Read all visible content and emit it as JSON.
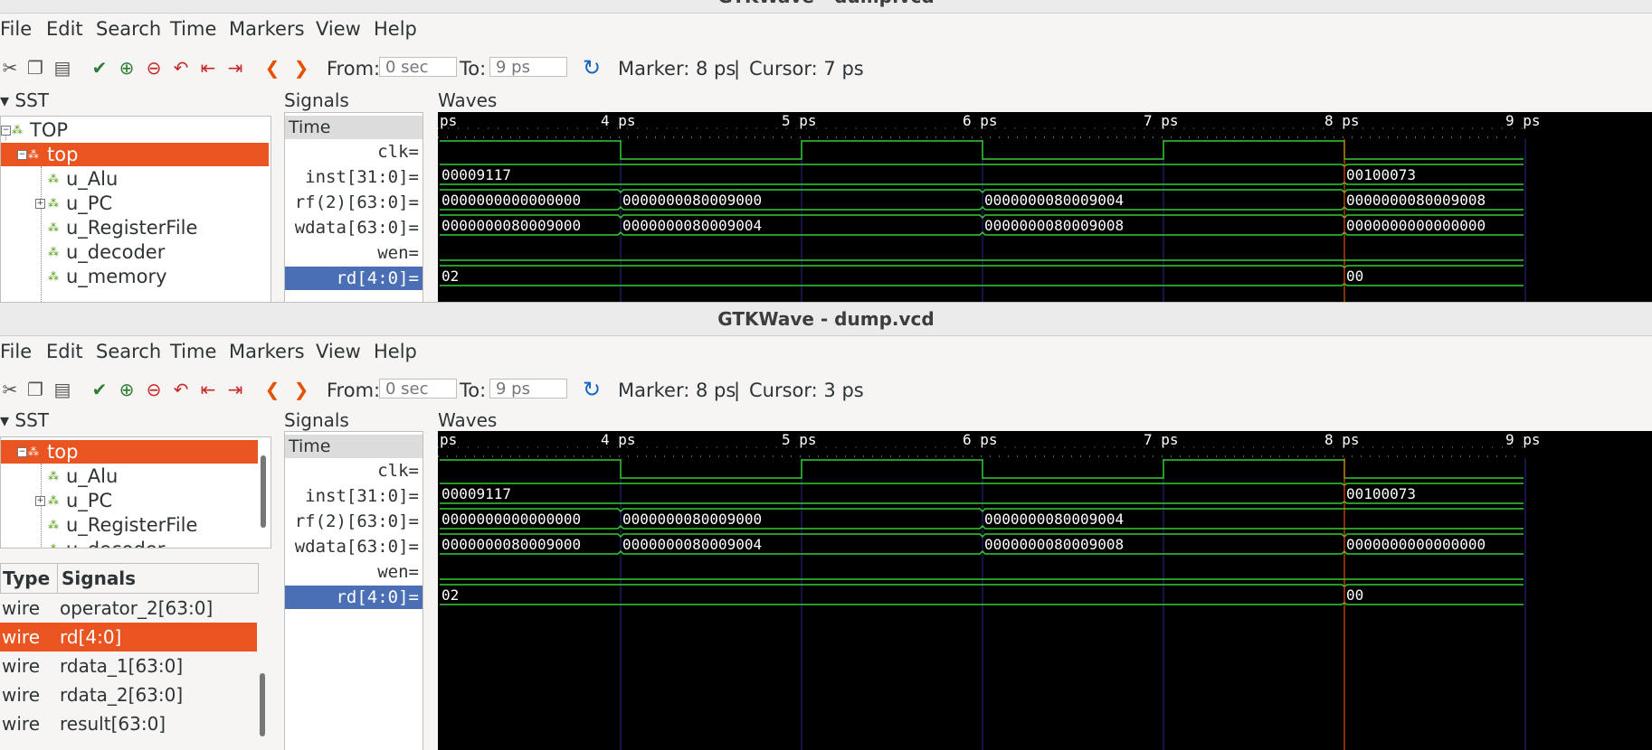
{
  "top_window": {
    "title": "GTKWave - dump.vcd",
    "cursor": "Cursor: 7 ps"
  },
  "bottom_window": {
    "title": "GTKWave - dump.vcd",
    "cursor": "Cursor: 3 ps"
  },
  "menu": [
    "File",
    "Edit",
    "Search",
    "Time",
    "Markers",
    "View",
    "Help"
  ],
  "toolbar": {
    "icons": [
      "cut-icon",
      "copy-icon",
      "paste-icon",
      "zoom-fit-icon",
      "zoom-in-icon",
      "zoom-out-icon",
      "undo-zoom-icon",
      "zoom-start-icon",
      "zoom-end-icon",
      "prev-edge-icon",
      "next-edge-icon",
      "reload-icon"
    ],
    "from_label": "From:",
    "from_value": "0 sec",
    "to_label": "To:",
    "to_value": "9 ps",
    "marker": "Marker: 8 ps",
    "separator": "|"
  },
  "panes": {
    "sst": "SST",
    "signals": "Signals",
    "waves": "Waves",
    "time": "Time"
  },
  "tree_top": [
    "TOP",
    "top",
    "u_Alu",
    "u_PC",
    "u_RegisterFile",
    "u_decoder",
    "u_memory"
  ],
  "tree_bottom": [
    "top",
    "u_Alu",
    "u_PC",
    "u_RegisterFile",
    "u_decoder"
  ],
  "signals": [
    "clk=",
    "inst[31:0]=",
    "rf(2)[63:0]=",
    "wdata[63:0]=",
    "wen=",
    "rd[4:0]="
  ],
  "ruler": [
    "ps",
    "4 ps",
    "5 ps",
    "6 ps",
    "7 ps",
    "8 ps",
    "9 ps"
  ],
  "wave_values": {
    "inst": [
      "00009117",
      "00100073"
    ],
    "rf_top": [
      "0000000000000000",
      "0000000080009000",
      "0000000080009004",
      "0000000080009008"
    ],
    "rf_bottom": [
      "0000000000000000",
      "0000000080009000",
      "0000000080009004"
    ],
    "wdata": [
      "0000000080009000",
      "0000000080009004",
      "0000000080009008",
      "0000000000000000"
    ],
    "rd": [
      "02",
      "00"
    ]
  },
  "type_list": {
    "headers": [
      "Type",
      "Signals"
    ],
    "rows": [
      {
        "type": "wire",
        "name": "operator_2[63:0]"
      },
      {
        "type": "wire",
        "name": "rd[4:0]"
      },
      {
        "type": "wire",
        "name": "rdata_1[63:0]"
      },
      {
        "type": "wire",
        "name": "rdata_2[63:0]"
      },
      {
        "type": "wire",
        "name": "result[63:0]"
      }
    ]
  },
  "colors": {
    "wave": "#33cc33",
    "grid": "#1a1a6a",
    "marker": "#ff6600",
    "selection_tree": "#e95420",
    "selection_signal": "#4a6fb5"
  }
}
